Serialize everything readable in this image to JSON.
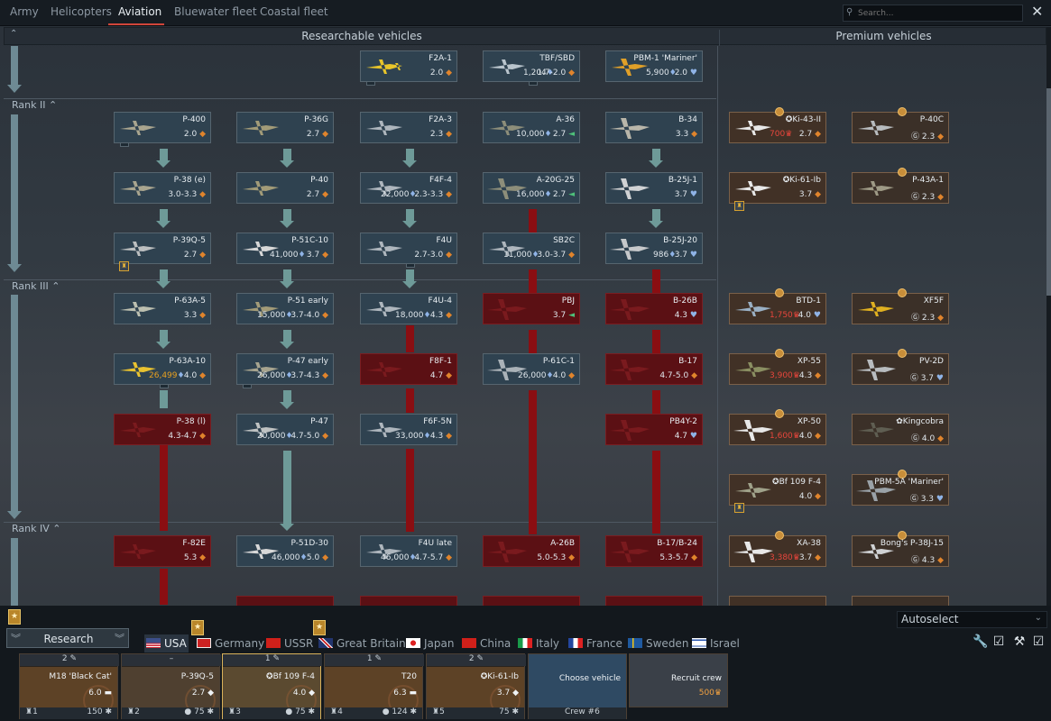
{
  "top_tabs": [
    {
      "label": "Army"
    },
    {
      "label": "Helicopters"
    },
    {
      "label": "Aviation"
    },
    {
      "label": "Bluewater fleet"
    },
    {
      "label": "Coastal fleet"
    }
  ],
  "search": {
    "placeholder": "Search..."
  },
  "headers": {
    "research": "Researchable vehicles",
    "premium": "Premium vehicles"
  },
  "ranks": {
    "r2": "Rank II",
    "r3": "Rank III",
    "r4": "Rank IV"
  },
  "vehicles": {
    "f2a1": {
      "name": "F2A-1",
      "br": "2.0"
    },
    "tbf": {
      "name": "TBF/SBD",
      "cost": "1,204",
      "br": "1.7-2.0"
    },
    "pbm1": {
      "name": "PBM-1 'Mariner'",
      "cost": "5,900",
      "br": "2.0"
    },
    "p400": {
      "name": "P-400",
      "br": "2.0"
    },
    "p36g": {
      "name": "P-36G",
      "br": "2.7"
    },
    "f2a3": {
      "name": "F2A-3",
      "br": "2.3"
    },
    "a36": {
      "name": "A-36",
      "cost": "10,000",
      "br": "2.7"
    },
    "b34": {
      "name": "B-34",
      "br": "3.3"
    },
    "ki43": {
      "name": "Ki-43-II",
      "cost": "700",
      "br": "2.7"
    },
    "p40c": {
      "name": "P-40C",
      "br": "2.3"
    },
    "p38e": {
      "name": "P-38 (e)",
      "br": "3.0-3.3"
    },
    "p40": {
      "name": "P-40",
      "br": "2.7"
    },
    "f4f4": {
      "name": "F4F-4",
      "cost": "22,000",
      "br": "2.3-3.3"
    },
    "a20g": {
      "name": "A-20G-25",
      "cost": "16,000",
      "br": "2.7"
    },
    "b25j1": {
      "name": "B-25J-1",
      "br": "3.7"
    },
    "ki61": {
      "name": "Ki-61-Ib",
      "br": "3.7"
    },
    "p43a": {
      "name": "P-43A-1",
      "br": "2.3"
    },
    "p39q": {
      "name": "P-39Q-5",
      "br": "2.7"
    },
    "p51c": {
      "name": "P-51C-10",
      "cost": "41,000",
      "br": "3.7"
    },
    "f4u": {
      "name": "F4U",
      "br": "2.7-3.0"
    },
    "sb2c": {
      "name": "SB2C",
      "cost": "11,000",
      "br": "3.0-3.7"
    },
    "b25j20": {
      "name": "B-25J-20",
      "cost": "986",
      "br": "3.7"
    },
    "p63a5": {
      "name": "P-63A-5",
      "br": "3.3"
    },
    "p51e": {
      "name": "P-51 early",
      "cost": "15,000",
      "br": "3.7-4.0"
    },
    "f4u4": {
      "name": "F4U-4",
      "cost": "18,000",
      "br": "4.3"
    },
    "pbj": {
      "name": "PBJ",
      "br": "3.7"
    },
    "b26b": {
      "name": "B-26B",
      "br": "4.3"
    },
    "btd1": {
      "name": "BTD-1",
      "cost": "1,750",
      "br": "4.0"
    },
    "xf5f": {
      "name": "XF5F",
      "br": "2.3"
    },
    "p63a10": {
      "name": "P-63A-10",
      "cost": "26,499",
      "br": "4.0"
    },
    "p47e": {
      "name": "P-47 early",
      "cost": "26,000",
      "br": "3.7-4.3"
    },
    "f8f1": {
      "name": "F8F-1",
      "br": "4.7"
    },
    "p61": {
      "name": "P-61C-1",
      "cost": "26,000",
      "br": "4.0"
    },
    "b17": {
      "name": "B-17",
      "br": "4.7-5.0"
    },
    "xp55": {
      "name": "XP-55",
      "cost": "3,900",
      "br": "4.3"
    },
    "pv2d": {
      "name": "PV-2D",
      "br": "3.7"
    },
    "p38l": {
      "name": "P-38 (l)",
      "br": "4.3-4.7"
    },
    "p47": {
      "name": "P-47",
      "cost": "20,000",
      "br": "4.7-5.0"
    },
    "f6f": {
      "name": "F6F-5N",
      "cost": "33,000",
      "br": "4.3"
    },
    "pb4y": {
      "name": "PB4Y-2",
      "br": "4.7"
    },
    "xp50": {
      "name": "XP-50",
      "cost": "1,600",
      "br": "4.0"
    },
    "kingcobra": {
      "name": "Kingcobra",
      "br": "4.0"
    },
    "bf109": {
      "name": "Bf 109 F-4",
      "br": "4.0"
    },
    "pbm5a": {
      "name": "PBM-5A 'Mariner'",
      "br": "3.3"
    },
    "f82e": {
      "name": "F-82E",
      "br": "5.3"
    },
    "p51d": {
      "name": "P-51D-30",
      "cost": "46,000",
      "br": "5.0"
    },
    "f4ul": {
      "name": "F4U late",
      "cost": "46,000",
      "br": "4.7-5.7"
    },
    "a26b": {
      "name": "A-26B",
      "br": "5.0-5.3"
    },
    "b17b24": {
      "name": "B-17/B-24",
      "br": "5.3-5.7"
    },
    "xa38": {
      "name": "XA-38",
      "cost": "3,380",
      "br": "3.7"
    },
    "p38j": {
      "name": "Bong's P-38J-15",
      "br": "4.3"
    }
  },
  "bottom": {
    "research_label": "Research",
    "autoselect": "Autoselect",
    "nations": [
      {
        "label": "USA"
      },
      {
        "label": "Germany"
      },
      {
        "label": "USSR"
      },
      {
        "label": "Great Britain"
      },
      {
        "label": "Japan"
      },
      {
        "label": "China"
      },
      {
        "label": "Italy"
      },
      {
        "label": "France"
      },
      {
        "label": "Sweden"
      },
      {
        "label": "Israel"
      }
    ],
    "crew": [
      {
        "top": "2",
        "name": "M18 'Black Cat'",
        "br": "6.0",
        "slot": "1",
        "pts": "150"
      },
      {
        "top": "–",
        "name": "P-39Q-5",
        "br": "2.7",
        "slot": "2",
        "pts": "75"
      },
      {
        "top": "1",
        "name": "Bf 109 F-4",
        "br": "4.0",
        "slot": "3",
        "pts": "75"
      },
      {
        "top": "1",
        "name": "T20",
        "br": "6.3",
        "slot": "4",
        "pts": "124"
      },
      {
        "top": "2",
        "name": "Ki-61-Ib",
        "br": "3.7",
        "slot": "5",
        "pts": "75"
      }
    ],
    "choose": "Choose vehicle",
    "crew6": "Crew #6",
    "recruit": "Recruit crew",
    "recruit_cost": "500"
  }
}
